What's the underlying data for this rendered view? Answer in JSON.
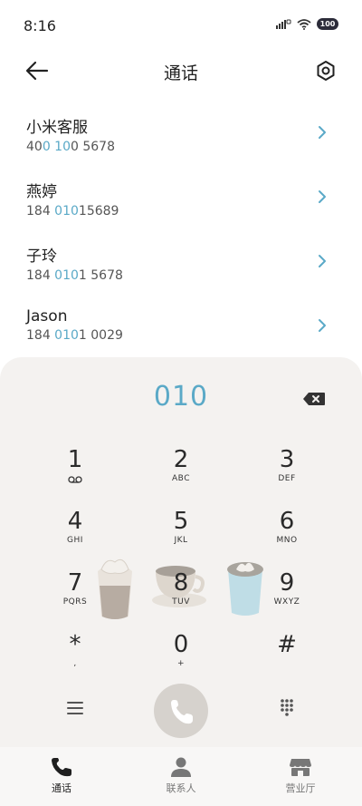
{
  "status": {
    "time": "8:16",
    "battery": "100"
  },
  "header": {
    "title": "通话"
  },
  "contacts": [
    {
      "name": "小米客服",
      "num_pre": "40",
      "num_hl": "0 10",
      "num_post": "0 5678"
    },
    {
      "name": "燕婷",
      "num_pre": "184 ",
      "num_hl": "010",
      "num_post": "15689"
    },
    {
      "name": "子玲",
      "num_pre": "184 ",
      "num_hl": "010",
      "num_post": "1 5678"
    },
    {
      "name": "Jason",
      "num_pre": "184 ",
      "num_hl": "010",
      "num_post": "1 0029"
    }
  ],
  "dialpad": {
    "input": "010",
    "keys": [
      {
        "digit": "1",
        "sub": ""
      },
      {
        "digit": "2",
        "sub": "ABC"
      },
      {
        "digit": "3",
        "sub": "DEF"
      },
      {
        "digit": "4",
        "sub": "GHI"
      },
      {
        "digit": "5",
        "sub": "JKL"
      },
      {
        "digit": "6",
        "sub": "MNO"
      },
      {
        "digit": "7",
        "sub": "PQRS"
      },
      {
        "digit": "8",
        "sub": "TUV"
      },
      {
        "digit": "9",
        "sub": "WXYZ"
      },
      {
        "digit": "*",
        "sub": ","
      },
      {
        "digit": "0",
        "sub": "+"
      },
      {
        "digit": "#",
        "sub": ""
      }
    ]
  },
  "tabs": [
    {
      "label": "通话",
      "icon": "phone-icon"
    },
    {
      "label": "联系人",
      "icon": "person-icon"
    },
    {
      "label": "营业厅",
      "icon": "store-icon"
    }
  ],
  "colors": {
    "accent": "#5aa9c7",
    "dialpad_bg": "#f4f2f0",
    "call_button": "#d6d2cd"
  }
}
